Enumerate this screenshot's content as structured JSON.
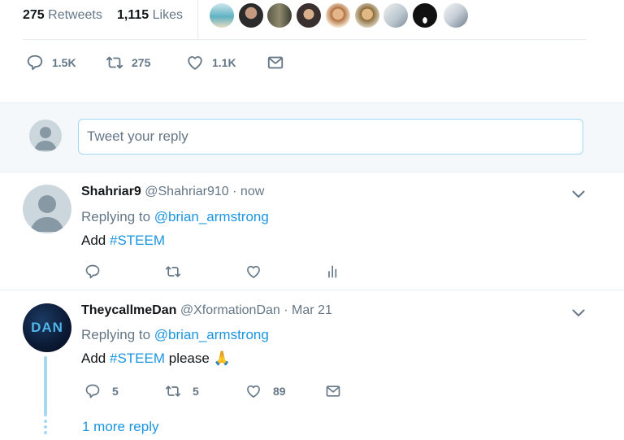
{
  "stats": {
    "retweets_count": "275",
    "retweets_label": "Retweets",
    "likes_count": "1,115",
    "likes_label": "Likes"
  },
  "main_actions": {
    "replies": "1.5K",
    "retweets": "275",
    "likes": "1.1K"
  },
  "reply_box": {
    "placeholder": "Tweet your reply"
  },
  "replies": [
    {
      "name": "Shahriar9",
      "handle": "@Shahriar910",
      "time": "· now",
      "replying_prefix": "Replying to",
      "replying_to": "@brian_armstrong",
      "text_prefix": "Add",
      "hashtag": "#STEEM",
      "text_suffix": "",
      "reply_count": "",
      "retweet_count": "",
      "like_count": ""
    },
    {
      "name": "TheycallmeDan",
      "handle": "@XformationDan",
      "time": "· Mar 21",
      "avatar_text": "DAN",
      "replying_prefix": "Replying to",
      "replying_to": "@brian_armstrong",
      "text_prefix": "Add",
      "hashtag": "#STEEM",
      "text_suffix": "please",
      "emoji": "🙏",
      "reply_count": "5",
      "retweet_count": "5",
      "like_count": "89"
    }
  ],
  "more_replies": "1 more reply",
  "colors": {
    "accent": "#1b95e0",
    "muted": "#657786",
    "thread_line": "#a7d8f0"
  }
}
